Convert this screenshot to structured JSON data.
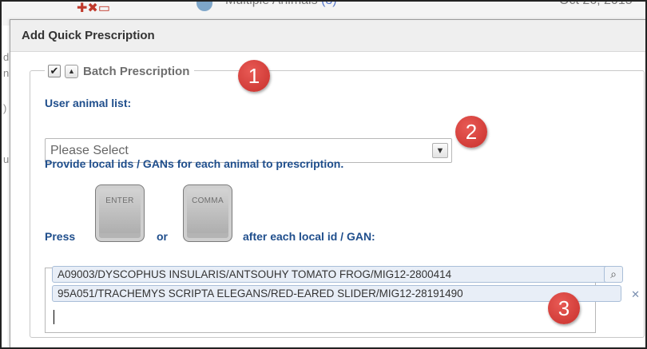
{
  "background": {
    "title_text": "Multiple Animals",
    "title_count": "(3)",
    "date_text": "Oct 26, 2015",
    "left_fragments": [
      "d",
      "n",
      ")",
      "u"
    ]
  },
  "dialog": {
    "title": "Add Quick Prescription",
    "batch": {
      "checkbox_checked": true,
      "checkbox_glyph": "✔",
      "collapse_glyph": "▲",
      "label": "Batch Prescription"
    },
    "user_animal_list": {
      "label": "User animal list:",
      "selected": "Please Select",
      "arrow_glyph": "⌄"
    },
    "instructions": "Provide local ids / GANs for each animal to prescription.",
    "press": {
      "press_word": "Press",
      "or_word": "or",
      "after_text": "after each local id / GAN:",
      "key1": "ENTER",
      "key2": "COMMA"
    },
    "entries": {
      "tokens": [
        "A09003/DYSCOPHUS INSULARIS/ANTSOUHY TOMATO FROG/MIG12-2800414",
        "95A051/TRACHEMYS SCRIPTA ELEGANS/RED-EARED SLIDER/MIG12-28191490"
      ],
      "search_glyph": "🔍",
      "remove_glyph": "✕"
    }
  },
  "callouts": [
    "1",
    "2",
    "3"
  ],
  "colors": {
    "label_blue": "#1f4e8c",
    "callout_red": "#d63c37",
    "token_bg": "#e8eef7"
  }
}
